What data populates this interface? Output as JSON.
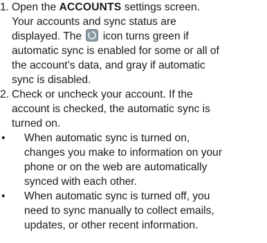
{
  "steps": [
    {
      "num": "1.",
      "line1_pre": "Open the ",
      "line1_bold": "ACCOUNTS",
      "line1_post": " settings screen.",
      "line2": "Your accounts and sync status are",
      "line3_pre": "displayed. The ",
      "icon": "sync-status-icon",
      "line3_post": " icon turns green if",
      "line4": "automatic sync is enabled for some or all of",
      "line5": "the account’s data, and gray if automatic",
      "line6": "sync is disabled."
    },
    {
      "num": "2.",
      "line1": "Check or uncheck your account. If the",
      "line2": "account is checked, the automatic sync is",
      "line3": "turned on."
    }
  ],
  "bullets": [
    {
      "marker": "•",
      "line1": "When automatic sync is turned on,",
      "line2": "changes you make to information on your",
      "line3": "phone or on the web are automatically",
      "line4": "synced with each other."
    },
    {
      "marker": "•",
      "line1": "When automatic sync is turned off, you",
      "line2": "need to sync manually to collect emails,",
      "line3": "updates, or other recent information."
    }
  ],
  "colors": {
    "text": "#1a1a1a",
    "icon_bg": "#8a9aa2",
    "icon_glyph": "#e8eef0"
  }
}
